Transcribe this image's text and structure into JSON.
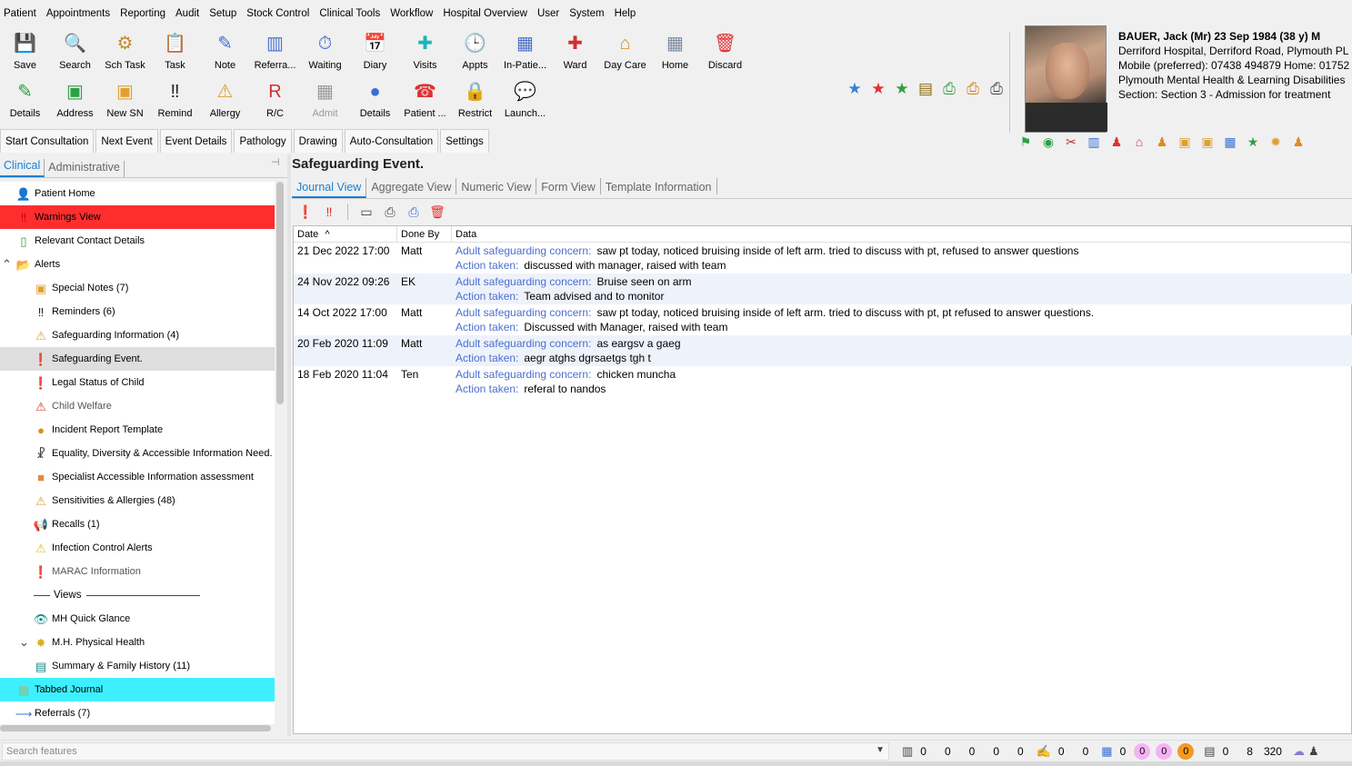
{
  "menu": [
    "Patient",
    "Appointments",
    "Reporting",
    "Audit",
    "Setup",
    "Stock Control",
    "Clinical Tools",
    "Workflow",
    "Hospital Overview",
    "User",
    "System",
    "Help"
  ],
  "toolbar_row1": [
    {
      "label": "Save",
      "icon": "save-icon",
      "glyph": "💾",
      "color": "#2ea043"
    },
    {
      "label": "Search",
      "icon": "search-icon",
      "glyph": "🔍",
      "color": "#333"
    },
    {
      "label": "Sch Task",
      "icon": "scheduled-task-icon",
      "glyph": "⚙",
      "color": "#c8892a"
    },
    {
      "label": "Task",
      "icon": "task-icon",
      "glyph": "📋",
      "color": "#d9a030"
    },
    {
      "label": "Note",
      "icon": "note-icon",
      "glyph": "✎",
      "color": "#4a6fd0"
    },
    {
      "label": "Referra...",
      "icon": "referral-icon",
      "glyph": "▥",
      "color": "#4a6fd0"
    },
    {
      "label": "Waiting",
      "icon": "waiting-icon",
      "glyph": "⏱",
      "color": "#4a6fd0"
    },
    {
      "label": "Diary",
      "icon": "diary-icon",
      "glyph": "📅",
      "color": "#c04040"
    },
    {
      "label": "Visits",
      "icon": "visits-icon",
      "glyph": "✚",
      "color": "#1bb5b5"
    },
    {
      "label": "Appts",
      "icon": "appointments-icon",
      "glyph": "🕒",
      "color": "#333"
    },
    {
      "label": "In-Patie...",
      "icon": "in-patient-icon",
      "glyph": "▦",
      "color": "#4a6fd0"
    },
    {
      "label": "Ward",
      "icon": "ward-icon",
      "glyph": "✚",
      "color": "#d03030"
    },
    {
      "label": "Day Care",
      "icon": "day-care-icon",
      "glyph": "⌂",
      "color": "#e08a20"
    },
    {
      "label": "Home",
      "icon": "home-building-icon",
      "glyph": "▦",
      "color": "#7a8aa0"
    },
    {
      "label": "Discard",
      "icon": "discard-trash-icon",
      "glyph": "🗑",
      "color": "#e03030"
    }
  ],
  "toolbar_row2": [
    {
      "label": "Details",
      "icon": "details-pencil-icon",
      "glyph": "✎",
      "color": "#2ea043",
      "disabled": false
    },
    {
      "label": "Address",
      "icon": "address-icon",
      "glyph": "▣",
      "color": "#2ea043",
      "disabled": false
    },
    {
      "label": "New SN",
      "icon": "new-special-note-icon",
      "glyph": "▣",
      "color": "#e0a030",
      "disabled": false
    },
    {
      "label": "Remind",
      "icon": "remind-icon",
      "glyph": "‼",
      "color": "#222",
      "disabled": false
    },
    {
      "label": "Allergy",
      "icon": "allergy-icon",
      "glyph": "⚠",
      "color": "#d9a030",
      "disabled": false
    },
    {
      "label": "R/C",
      "icon": "rc-icon",
      "glyph": "R",
      "color": "#d03030",
      "disabled": false
    },
    {
      "label": "Admit",
      "icon": "admit-icon",
      "glyph": "▦",
      "color": "#9a9a9a",
      "disabled": true
    },
    {
      "label": "Details",
      "icon": "details-circle-icon",
      "glyph": "●",
      "color": "#3a6fd0",
      "disabled": false
    },
    {
      "label": "Patient ...",
      "icon": "patient-phone-icon",
      "glyph": "☎",
      "color": "#e03030",
      "disabled": false
    },
    {
      "label": "Restrict",
      "icon": "restrict-lock-icon",
      "glyph": "🔒",
      "color": "#d9b020",
      "disabled": false
    },
    {
      "label": "Launch...",
      "icon": "launch-chat-icon",
      "glyph": "💬",
      "color": "#8a7ad0",
      "disabled": false
    }
  ],
  "quick_icons": [
    {
      "name": "blue-star-icon",
      "glyph": "★",
      "color": "#3a7fd0"
    },
    {
      "name": "red-star-icon",
      "glyph": "★",
      "color": "#e03030"
    },
    {
      "name": "green-star-icon",
      "glyph": "★",
      "color": "#2ea043"
    },
    {
      "name": "document-icon",
      "glyph": "▤",
      "color": "#8a6a10"
    },
    {
      "name": "print-green-icon",
      "glyph": "⎙",
      "color": "#2ea043"
    },
    {
      "name": "print-orange-icon",
      "glyph": "⎙",
      "color": "#d08020"
    },
    {
      "name": "print-icon",
      "glyph": "⎙",
      "color": "#444"
    }
  ],
  "patient": {
    "name_line": "BAUER, Jack (Mr) 23 Sep 1984 (38 y) M",
    "address": "Derriford Hospital, Derriford Road, Plymouth PL",
    "phone": "Mobile (preferred): 07438 494879 Home: 01752",
    "org": "Plymouth Mental Health & Learning Disabilities",
    "section": "Section: Section 3 - Admission for treatment"
  },
  "patient_icons": [
    {
      "name": "flag-icon",
      "glyph": "⚑",
      "color": "#2ea043"
    },
    {
      "name": "lac-badge-icon",
      "glyph": "◉",
      "color": "#2ea043"
    },
    {
      "name": "tools-icon",
      "glyph": "✂",
      "color": "#c03030"
    },
    {
      "name": "chart-icon",
      "glyph": "▥",
      "color": "#3a6fd0"
    },
    {
      "name": "person-red-icon",
      "glyph": "♟",
      "color": "#e03030"
    },
    {
      "name": "house-icon",
      "glyph": "⌂",
      "color": "#e03030"
    },
    {
      "name": "person-orange-icon",
      "glyph": "♟",
      "color": "#e08a20"
    },
    {
      "name": "note-orange-icon",
      "glyph": "▣",
      "color": "#e0a030"
    },
    {
      "name": "note-orange-2-icon",
      "glyph": "▣",
      "color": "#e0a030"
    },
    {
      "name": "calendar-icon",
      "glyph": "▦",
      "color": "#3a6fd0"
    },
    {
      "name": "star-green-icon",
      "glyph": "★",
      "color": "#2ea043"
    },
    {
      "name": "sun-icon",
      "glyph": "✹",
      "color": "#e0a030"
    },
    {
      "name": "person-icon",
      "glyph": "♟",
      "color": "#e08a20"
    }
  ],
  "actions": [
    "Start Consultation",
    "Next Event",
    "Event Details",
    "Pathology",
    "Drawing",
    "Auto-Consultation",
    "Settings"
  ],
  "left_tabs": [
    "Clinical",
    "Administrative"
  ],
  "tree": [
    {
      "label": "Patient Home",
      "icon": "patient-home-icon",
      "glyph": "👤",
      "color": "#2ea043",
      "indent": 18,
      "style": ""
    },
    {
      "label": "Warnings View",
      "icon": "warning-exclaim-icon",
      "glyph": "‼",
      "color": "#c00",
      "indent": 18,
      "style": "red"
    },
    {
      "label": "Relevant Contact Details",
      "icon": "contact-phone-icon",
      "glyph": "▯",
      "color": "#2ea043",
      "indent": 18,
      "style": ""
    },
    {
      "label": "Alerts",
      "icon": "alerts-folder-icon",
      "glyph": "📂",
      "color": "#d9b020",
      "indent": 18,
      "style": "",
      "chevron": "⌃"
    },
    {
      "label": "Special Notes (7)",
      "icon": "special-notes-icon",
      "glyph": "▣",
      "color": "#e0a030",
      "indent": 37,
      "style": ""
    },
    {
      "label": "Reminders (6)",
      "icon": "reminders-icon",
      "glyph": "‼",
      "color": "#222",
      "indent": 37,
      "style": ""
    },
    {
      "label": "Safeguarding Information (4)",
      "icon": "safeguarding-info-icon",
      "glyph": "⚠",
      "color": "#d9a030",
      "indent": 37,
      "style": ""
    },
    {
      "label": "Safeguarding Event.",
      "icon": "safeguarding-event-icon",
      "glyph": "❗",
      "color": "#e03030",
      "indent": 37,
      "style": "sel"
    },
    {
      "label": "Legal Status of Child",
      "icon": "legal-status-icon",
      "glyph": "❗",
      "color": "#e03030",
      "indent": 37,
      "style": ""
    },
    {
      "label": "Child Welfare",
      "icon": "child-welfare-icon",
      "glyph": "⚠",
      "color": "#e03030",
      "indent": 37,
      "style": "grey"
    },
    {
      "label": "Incident Report Template",
      "icon": "incident-report-icon",
      "glyph": "●",
      "color": "#e08a20",
      "indent": 37,
      "style": ""
    },
    {
      "label": "Equality, Diversity & Accessible Information Need.",
      "icon": "equality-person-icon",
      "glyph": "☧",
      "color": "#444",
      "indent": 37,
      "style": ""
    },
    {
      "label": "Specialist Accessible Information assessment",
      "icon": "specialist-info-icon",
      "glyph": "■",
      "color": "#e08a40",
      "indent": 37,
      "style": ""
    },
    {
      "label": "Sensitivities & Allergies (48)",
      "icon": "sensitivities-icon",
      "glyph": "⚠",
      "color": "#d9a030",
      "indent": 37,
      "style": ""
    },
    {
      "label": "Recalls (1)",
      "icon": "recalls-megaphone-icon",
      "glyph": "📢",
      "color": "#d9b020",
      "indent": 37,
      "style": ""
    },
    {
      "label": "Infection Control Alerts",
      "icon": "infection-control-icon",
      "glyph": "⚠",
      "color": "#e0c020",
      "indent": 37,
      "style": ""
    },
    {
      "label": "MARAC Information",
      "icon": "marac-icon",
      "glyph": "❗",
      "color": "#e03030",
      "indent": 37,
      "style": "grey"
    },
    {
      "label": "Views",
      "icon": "views-divider-icon",
      "glyph": "",
      "color": "#444",
      "indent": 37,
      "style": "divider"
    },
    {
      "label": "MH Quick Glance",
      "icon": "eye-icon",
      "glyph": "👁",
      "color": "#1a8a8a",
      "indent": 37,
      "style": ""
    },
    {
      "label": "M.H. Physical Health",
      "icon": "physical-health-icon",
      "glyph": "✸",
      "color": "#d9b020",
      "indent": 37,
      "style": "",
      "chevron": "⌄"
    },
    {
      "label": "Summary & Family History (11)",
      "icon": "summary-book-icon",
      "glyph": "▤",
      "color": "#1a8a8a",
      "indent": 37,
      "style": ""
    },
    {
      "label": "Tabbed Journal",
      "icon": "tabbed-journal-icon",
      "glyph": "▤",
      "color": "#d9a030",
      "indent": 18,
      "style": "cyan"
    },
    {
      "label": "Referrals (7)",
      "icon": "referrals-arrow-icon",
      "glyph": "⟶",
      "color": "#3a6fd0",
      "indent": 18,
      "style": ""
    }
  ],
  "main": {
    "title": "Safeguarding Event.",
    "view_tabs": [
      "Journal View",
      "Aggregate View",
      "Numeric View",
      "Form View",
      "Template Information"
    ],
    "columns": [
      "Date",
      "Done By",
      "Data"
    ],
    "sort_indicator": "^",
    "concern_key": "Adult safeguarding concern:",
    "action_key": "Action taken:",
    "rows": [
      {
        "date": "21 Dec 2022 17:00",
        "by": "Matt",
        "concern": "saw pt today, noticed bruising inside of left arm. tried to discuss with pt, refused to answer questions",
        "action": "discussed with manager, raised with team"
      },
      {
        "date": "24 Nov 2022 09:26",
        "by": "EK",
        "concern": "Bruise seen on arm",
        "action": "Team advised and to monitor"
      },
      {
        "date": "14 Oct 2022 17:00",
        "by": "Matt",
        "concern": "saw pt today, noticed bruising inside of left arm. tried to discuss with pt, pt refused to answer questions.",
        "action": "Discussed with Manager, raised with team"
      },
      {
        "date": "20 Feb 2020 11:09",
        "by": "Matt",
        "concern": "as eargsv a gaeg",
        "action": "aegr atghs dgrsaetgs tgh t"
      },
      {
        "date": "18 Feb 2020 11:04",
        "by": "Ten",
        "concern": "chicken muncha",
        "action": "referal to nandos"
      }
    ]
  },
  "status": {
    "search_placeholder": "Search features",
    "counters_a": [
      "0",
      "0",
      "0",
      "0",
      "0"
    ],
    "counters_b": [
      "0",
      "0"
    ],
    "counter_c": "0",
    "bubbles": [
      "0",
      "0",
      "0"
    ],
    "counters_d": [
      "0",
      "8",
      "320"
    ]
  }
}
